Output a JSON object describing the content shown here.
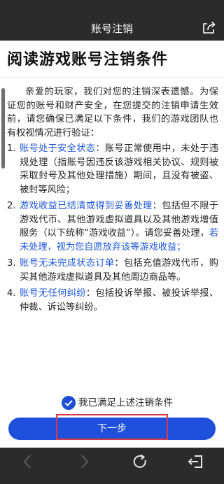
{
  "header": {
    "title": "账号注销",
    "share_icon": "share-export-icon"
  },
  "page": {
    "heading": "阅读游戏账号注销条件",
    "intro": "亲爱的玩家，我们对您的注销深表遗憾。为保证您的账号和财产安全，在您提交的注销申请生效前，请您确保已满足以下条件，我们的游戏团队也有权视情况进行验证：",
    "conditions": [
      {
        "num": "1.",
        "title": "账号处于安全状态",
        "text": "：账号正常使用中，未处于违规处理（指账号因违反该游戏相关协议、规则被采取封号及其他处理措施）期间，且没有被盗、被封等风险；",
        "extra": ""
      },
      {
        "num": "2.",
        "title": "游戏收益已结清或得到妥善处理",
        "text": "：包括但不限于游戏代币、其他游戏虚拟道具以及其他游戏增值服务（以下统称“游戏收益”）。请您妥善处理，",
        "extra": "若未处理，视为您自愿放弃该等游戏收益；"
      },
      {
        "num": "3.",
        "title": "账号无未完成状态订单",
        "text": "：包括充值游戏代币，购买其他游戏虚拟道具及其他周边商品等。",
        "extra": ""
      },
      {
        "num": "4.",
        "title": "账号无任何纠纷",
        "text": "：包括投诉举报、被投诉举报、仲裁、诉讼等纠纷。",
        "extra": ""
      }
    ]
  },
  "footer": {
    "agree_label": "我已满足上述注销条件",
    "agree_checked": true,
    "next_label": "下一步",
    "accent": "#1e50dc",
    "highlight_color": "#d63a44"
  },
  "navbar": {
    "icons": [
      "back-icon",
      "forward-icon",
      "reload-icon",
      "exit-icon"
    ]
  }
}
